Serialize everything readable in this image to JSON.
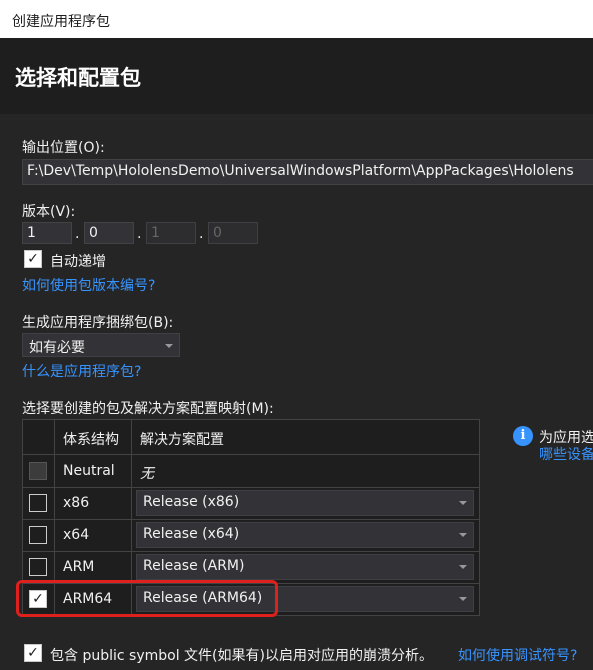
{
  "window": {
    "title": "创建应用程序包"
  },
  "header": {
    "title": "选择和配置包"
  },
  "output": {
    "label": "输出位置(O):",
    "value": "F:\\Dev\\Temp\\HololensDemo\\UniversalWindowsPlatform\\AppPackages\\Hololens"
  },
  "version": {
    "label": "版本(V):",
    "parts": [
      "1",
      "0",
      "1",
      "0"
    ],
    "dot": ".",
    "auto_increment_label": "自动递增",
    "auto_increment_checked": true,
    "help_link": "如何使用包版本编号?"
  },
  "bundle": {
    "label": "生成应用程序捆绑包(B):",
    "selected": "如有必要",
    "help_link": "什么是应用程序包?"
  },
  "packages": {
    "label": "选择要创建的包及解决方案配置映射(M):",
    "headers": {
      "arch": "体系结构",
      "config": "解决方案配置"
    },
    "rows": [
      {
        "arch": "Neutral",
        "config": "无",
        "checked": false,
        "disabled": true
      },
      {
        "arch": "x86",
        "config": "Release (x86)",
        "checked": false
      },
      {
        "arch": "x64",
        "config": "Release (x64)",
        "checked": false
      },
      {
        "arch": "ARM",
        "config": "Release (ARM)",
        "checked": false
      },
      {
        "arch": "ARM64",
        "config": "Release (ARM64)",
        "checked": true
      }
    ]
  },
  "info": {
    "line1": "为应用选",
    "line2": "哪些设备"
  },
  "symbols": {
    "label": "包含 public symbol 文件(如果有)以启用对应用的崩溃分析。",
    "checked": true,
    "help_link": "如何使用调试符号?"
  },
  "colors": {
    "background": "#252526",
    "link": "#3794ff",
    "highlight": "#e0201c"
  }
}
